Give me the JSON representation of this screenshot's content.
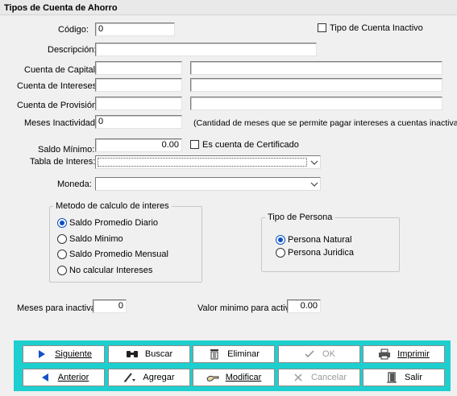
{
  "window": {
    "title": "Tipos de Cuenta de Ahorro"
  },
  "form": {
    "codigo": {
      "label": "Código:",
      "value": "0"
    },
    "tipo_inactivo": {
      "label": "Tipo de Cuenta Inactivo",
      "checked": false
    },
    "descripcion": {
      "label": "Descripción:",
      "value": ""
    },
    "cuenta_capital": {
      "label": "Cuenta de Capital:",
      "code": "",
      "name": ""
    },
    "cuenta_intereses": {
      "label": "Cuenta de Intereses:",
      "code": "",
      "name": ""
    },
    "cuenta_provision": {
      "label": "Cuenta de Provisión:",
      "code": "",
      "name": ""
    },
    "meses_inactividad": {
      "label": "Meses Inactividad:",
      "value": "0",
      "hint": "(Cantidad de meses que se permite pagar intereses a cuentas inactivas)"
    },
    "saldo_minimo": {
      "label": "Saldo Mínimo:",
      "value": "0.00"
    },
    "es_certificado": {
      "label": "Es cuenta de Certificado",
      "checked": false
    },
    "tabla_interes": {
      "label": "Tabla de Interes:",
      "value": ""
    },
    "moneda": {
      "label": "Moneda:",
      "value": ""
    },
    "metodo_calculo": {
      "legend": "Metodo de calculo de interes",
      "options": [
        "Saldo Promedio Diario",
        "Saldo Minimo",
        "Saldo Promedio Mensual",
        "No calcular Intereses"
      ],
      "selected": "Saldo Promedio Diario"
    },
    "tipo_persona": {
      "legend": "Tipo de Persona",
      "options": [
        "Persona Natural",
        "Persona Juridica"
      ],
      "selected": "Persona Natural"
    },
    "meses_para_inactivar": {
      "label": "Meses para inactivar",
      "value": "0"
    },
    "valor_minimo_activar": {
      "label": "Valor minimo para activar",
      "value": "0.00"
    }
  },
  "toolbar": {
    "siguiente": "Siguiente",
    "buscar": "Buscar",
    "eliminar": "Eliminar",
    "ok": "OK",
    "imprimir": "Imprimir",
    "anterior": "Anterior",
    "agregar": "Agregar",
    "modificar": "Modificar",
    "cancelar": "Cancelar",
    "salir": "Salir"
  },
  "icons": {
    "siguiente": "triangle-right-icon",
    "anterior": "triangle-left-icon",
    "buscar": "binoculars-icon",
    "eliminar": "trash-icon",
    "ok": "check-icon",
    "imprimir": "printer-icon",
    "agregar": "pencil-icon",
    "modificar": "hand-pen-icon",
    "cancelar": "x-icon",
    "salir": "exit-door-icon"
  },
  "colors": {
    "toolbar_bg": "#1ecfcf",
    "accent_blue": "#0a4fc8"
  }
}
